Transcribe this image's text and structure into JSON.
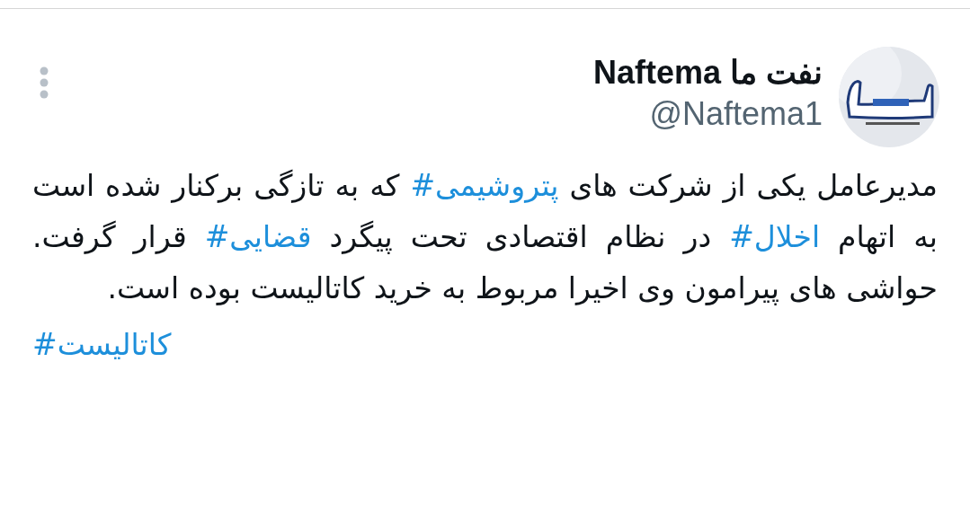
{
  "tweet": {
    "author": {
      "display_name": "نفت ما Naftema",
      "handle": "@Naftema1"
    },
    "body": [
      {
        "kind": "text",
        "text": "مدیرعامل یکی از شرکت های"
      },
      {
        "kind": "hashtag",
        "text": "#پتروشیمی"
      },
      {
        "kind": "text",
        "text": "که به تازگی برکنار شده است به اتهام"
      },
      {
        "kind": "hashtag",
        "text": "#اخلال"
      },
      {
        "kind": "text",
        "text": "در نظام اقتصادی تحت پیگرد"
      },
      {
        "kind": "hashtag",
        "text": "#قضایی"
      },
      {
        "kind": "text",
        "text": "قرار گرفت. حواشی های پیرامون وی اخیرا مربوط به خرید کاتالیست بوده است."
      }
    ],
    "footer_hashtag": "#کاتالیست"
  }
}
